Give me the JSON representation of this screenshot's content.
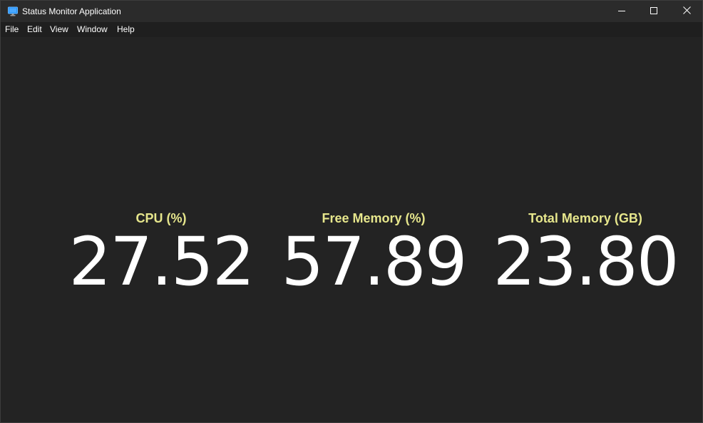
{
  "window": {
    "title": "Status Monitor Application",
    "app_icon": "monitor-icon",
    "controls": {
      "minimize_icon": "minimize-icon",
      "maximize_icon": "maximize-icon",
      "close_icon": "close-icon"
    }
  },
  "menu": {
    "items": [
      "File",
      "Edit",
      "View",
      "Window",
      "Help"
    ]
  },
  "stats": {
    "cpu": {
      "label": "CPU (%)",
      "value": "27.52"
    },
    "free_memory": {
      "label": "Free Memory (%)",
      "value": "57.89"
    },
    "total_memory": {
      "label": "Total Memory (GB)",
      "value": "23.80"
    }
  },
  "colors": {
    "background": "#232323",
    "label": "#e6e68c",
    "value": "#ffffff",
    "titlebar": "#2b2b2b"
  }
}
